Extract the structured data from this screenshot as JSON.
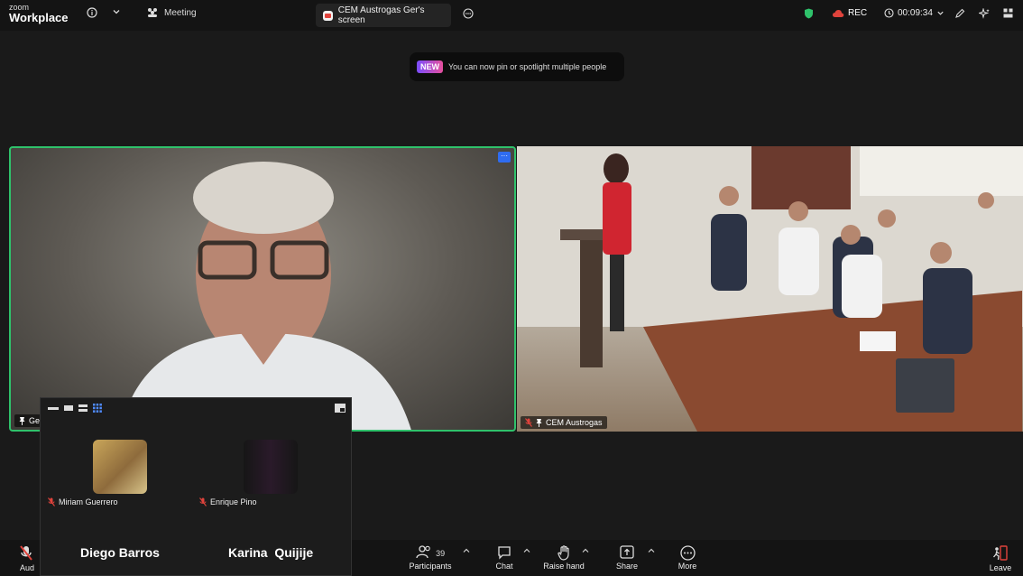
{
  "window": {
    "brand_small": "zoom",
    "brand": "Workplace",
    "meeting_label": "Meeting",
    "active_tab": "CEM Austrogas Ger's screen",
    "rec_label": "REC",
    "timer": "00:09:34"
  },
  "notice": {
    "badge": "NEW",
    "text": "You can now pin or spotlight multiple people"
  },
  "tiles": {
    "left_name": "Ger",
    "right_name": "CEM Austrogas",
    "menu_glyph": "···"
  },
  "gallery": {
    "participants": [
      {
        "name": "Miriam Guerrero"
      },
      {
        "name": "Enrique Pino"
      }
    ],
    "large_names": [
      "Diego Barros",
      "Karina  Quijije"
    ]
  },
  "toolbar": {
    "audio_label": "Aud",
    "participants_label": "Participants",
    "participants_count": "39",
    "chat_label": "Chat",
    "raise_hand_label": "Raise hand",
    "share_label": "Share",
    "more_label": "More",
    "leave_label": "Leave"
  },
  "colors": {
    "active_border": "#2fc26b",
    "accent_blue": "#2f6cf0",
    "rec_red": "#e0433c",
    "shield_green": "#2fc26b"
  }
}
